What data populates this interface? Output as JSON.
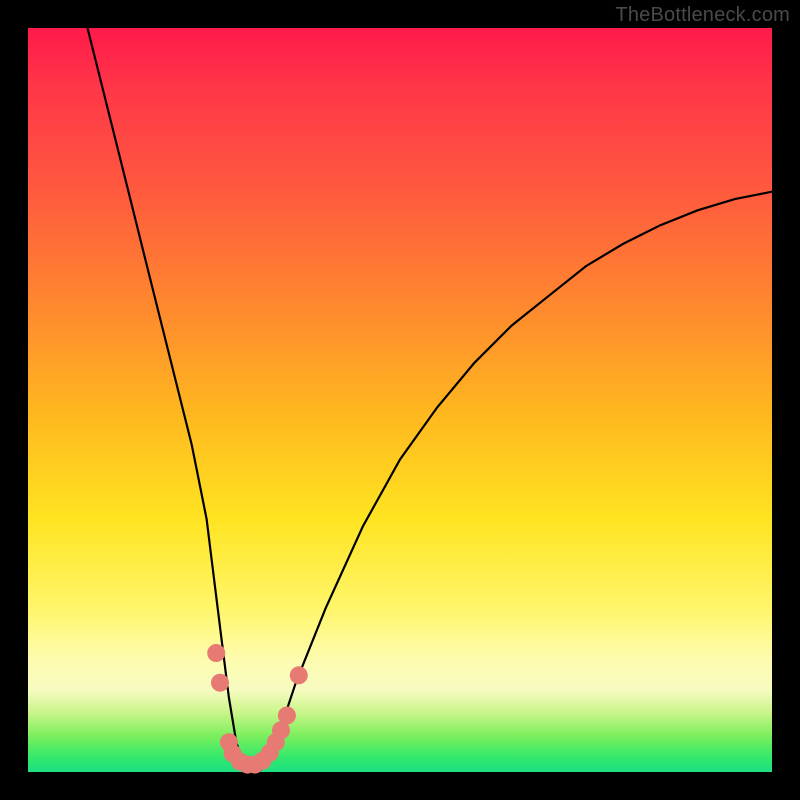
{
  "watermark": "TheBottleneck.com",
  "chart_data": {
    "type": "line",
    "title": "",
    "xlabel": "",
    "ylabel": "",
    "xlim": [
      0,
      100
    ],
    "ylim": [
      0,
      100
    ],
    "series": [
      {
        "name": "bottleneck-curve",
        "x": [
          8,
          10,
          12,
          14,
          16,
          18,
          20,
          22,
          24,
          25,
          26,
          27,
          28,
          29,
          30,
          31,
          32,
          33,
          34,
          36,
          40,
          45,
          50,
          55,
          60,
          65,
          70,
          75,
          80,
          85,
          90,
          95,
          100
        ],
        "y": [
          100,
          92,
          84,
          76,
          68,
          60,
          52,
          44,
          34,
          26,
          18,
          10,
          4,
          1,
          0,
          0,
          1,
          3,
          6,
          12,
          22,
          33,
          42,
          49,
          55,
          60,
          64,
          68,
          71,
          73.5,
          75.5,
          77,
          78
        ]
      }
    ],
    "markers": {
      "name": "highlight-dots",
      "color": "#e77b74",
      "points": [
        {
          "x": 25.3,
          "y": 16
        },
        {
          "x": 25.8,
          "y": 12
        },
        {
          "x": 27.0,
          "y": 4
        },
        {
          "x": 27.5,
          "y": 2.5
        },
        {
          "x": 28.5,
          "y": 1.4
        },
        {
          "x": 29.5,
          "y": 1.0
        },
        {
          "x": 30.5,
          "y": 1.0
        },
        {
          "x": 31.5,
          "y": 1.5
        },
        {
          "x": 32.5,
          "y": 2.6
        },
        {
          "x": 33.3,
          "y": 4.0
        },
        {
          "x": 34.0,
          "y": 5.6
        },
        {
          "x": 34.8,
          "y": 7.6
        },
        {
          "x": 36.4,
          "y": 13.0
        }
      ]
    }
  }
}
